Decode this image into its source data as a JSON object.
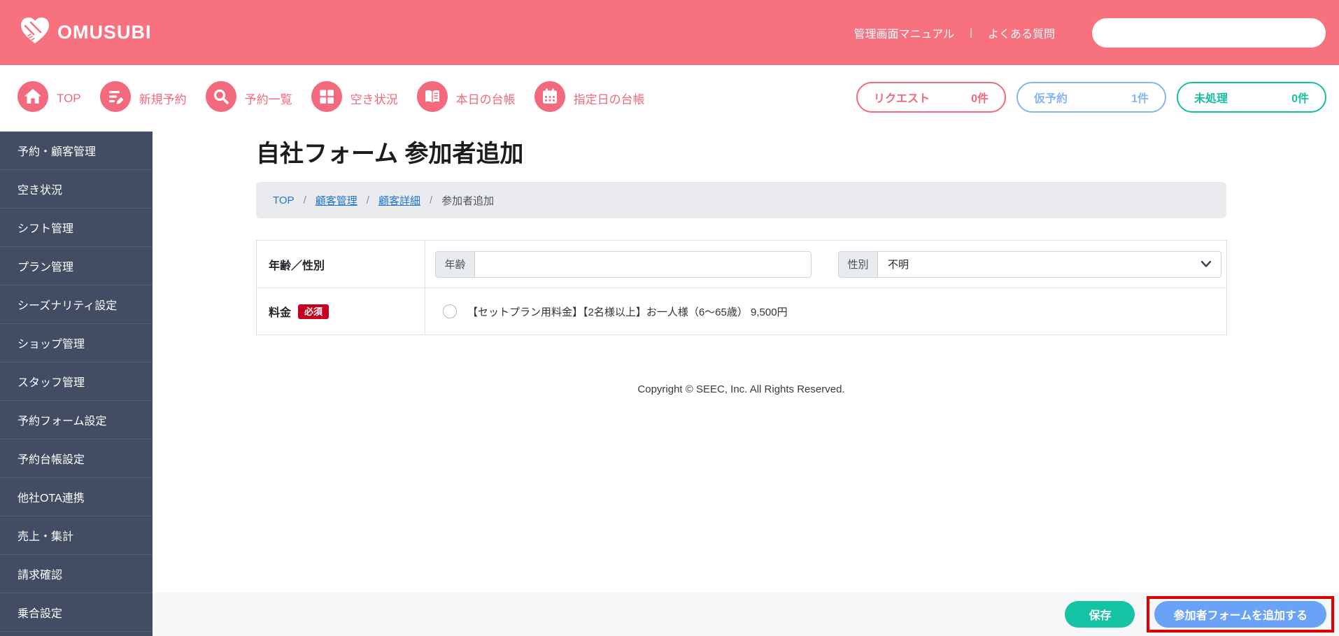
{
  "header": {
    "brand": "OMUSUBI",
    "manual_link": "管理画面マニュアル",
    "divider": "|",
    "faq_link": "よくある質問",
    "search_value": ""
  },
  "navbar": {
    "items": [
      {
        "label": "TOP",
        "icon": "home-icon"
      },
      {
        "label": "新規予約",
        "icon": "new-reservation-icon"
      },
      {
        "label": "予約一覧",
        "icon": "search-icon"
      },
      {
        "label": "空き状況",
        "icon": "grid-icon"
      },
      {
        "label": "本日の台帳",
        "icon": "book-icon"
      },
      {
        "label": "指定日の台帳",
        "icon": "calendar-icon"
      }
    ],
    "badges": [
      {
        "label": "リクエスト",
        "count": "0件",
        "color": "#f3697d"
      },
      {
        "label": "仮予約",
        "count": "1件",
        "color": "#85b5f4"
      },
      {
        "label": "未処理",
        "count": "0件",
        "color": "#13c0a0"
      }
    ]
  },
  "sidebar": {
    "items": [
      {
        "label": "予約・顧客管理"
      },
      {
        "label": "空き状況"
      },
      {
        "label": "シフト管理"
      },
      {
        "label": "プラン管理"
      },
      {
        "label": "シーズナリティ設定"
      },
      {
        "label": "ショップ管理"
      },
      {
        "label": "スタッフ管理"
      },
      {
        "label": "予約フォーム設定"
      },
      {
        "label": "予約台帳設定"
      },
      {
        "label": "他社OTA連携"
      },
      {
        "label": "売上・集計"
      },
      {
        "label": "請求確認"
      },
      {
        "label": "乗合設定"
      }
    ]
  },
  "main": {
    "title": "自社フォーム 参加者追加",
    "breadcrumb": {
      "separator": "/",
      "items": [
        {
          "label": "TOP"
        },
        {
          "label": "顧客管理"
        },
        {
          "label": "顧客詳細"
        },
        {
          "label": "参加者追加"
        }
      ]
    },
    "form": {
      "age_gender_label": "年齢／性別",
      "age_prefix": "年齢",
      "age_value": "",
      "gender_prefix": "性別",
      "gender_value": "不明",
      "price_label": "料金",
      "required_badge": "必須",
      "price_option": "【セットプラン用料金】【2名様以上】お一人様（6〜65歳） 9,500円"
    },
    "copyright": "Copyright © SEEC, Inc. All Rights Reserved."
  },
  "footer": {
    "save_label": "保存",
    "add_label": "参加者フォームを追加する"
  },
  "colors": {
    "header_pink": "#f8717f",
    "nav_pink": "#f3697d",
    "sidebar_navy": "#424d63",
    "link_blue": "#2176d2",
    "required_red": "#c7001e",
    "save_teal": "#14c3a3",
    "add_blue": "#6aa2f7",
    "highlight_red": "#e10000",
    "badge_request": "#f3697d",
    "badge_provisional": "#85b5f4",
    "badge_unprocessed": "#13c0a0"
  }
}
